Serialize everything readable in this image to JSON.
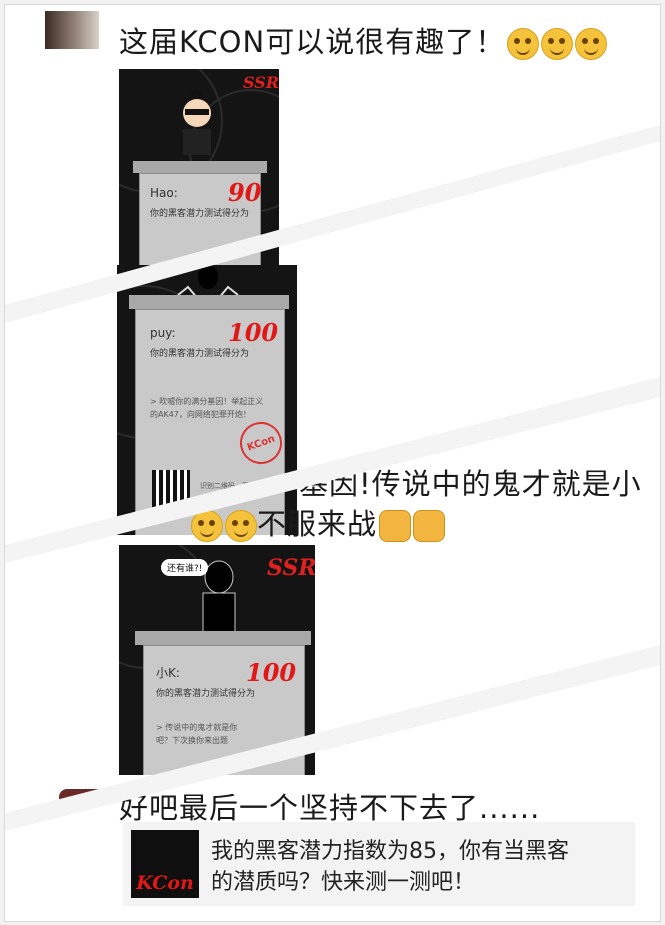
{
  "messages": [
    {
      "text": "这届KCON可以说很有趣了！",
      "emoji": "grinning-face"
    },
    {
      "text_visible": "基因!传说中的鬼才就是小",
      "text_line2": "不服来战",
      "emoji": "grinning-face",
      "extra": "fist"
    },
    {
      "text": "好吧最后一个坚持不下去了......"
    }
  ],
  "posters": [
    {
      "name": "Hao:",
      "line": "你的黑客潜力测试得分为",
      "score": "90",
      "brand": "SSR"
    },
    {
      "name": "puy:",
      "line": "你的黑客潜力测试得分为",
      "score": "100",
      "desc1": "> 吹嘘你的满分基因！举起正义",
      "desc2": "的AK47，向网络犯罪开炮！",
      "stamp": "KCon",
      "footer": "识别二维码，开始你的测试"
    },
    {
      "name": "小K:",
      "line": "你的黑客潜力测试得分为",
      "score": "100",
      "desc1": "> 传说中的鬼才就是你",
      "desc2": "吧？下次换你来出题",
      "speech": "还有谁?!",
      "brand": "SSR"
    }
  ],
  "share_card": {
    "logo_text": "KCon",
    "line1": "我的黑客潜力指数为85，你有当黑客",
    "line2": "的潜质吗？快来测一测吧！"
  },
  "colors": {
    "accent_red": "#e01818",
    "poster_bg": "#141414",
    "bubble_bg": "#f3f3f3"
  }
}
